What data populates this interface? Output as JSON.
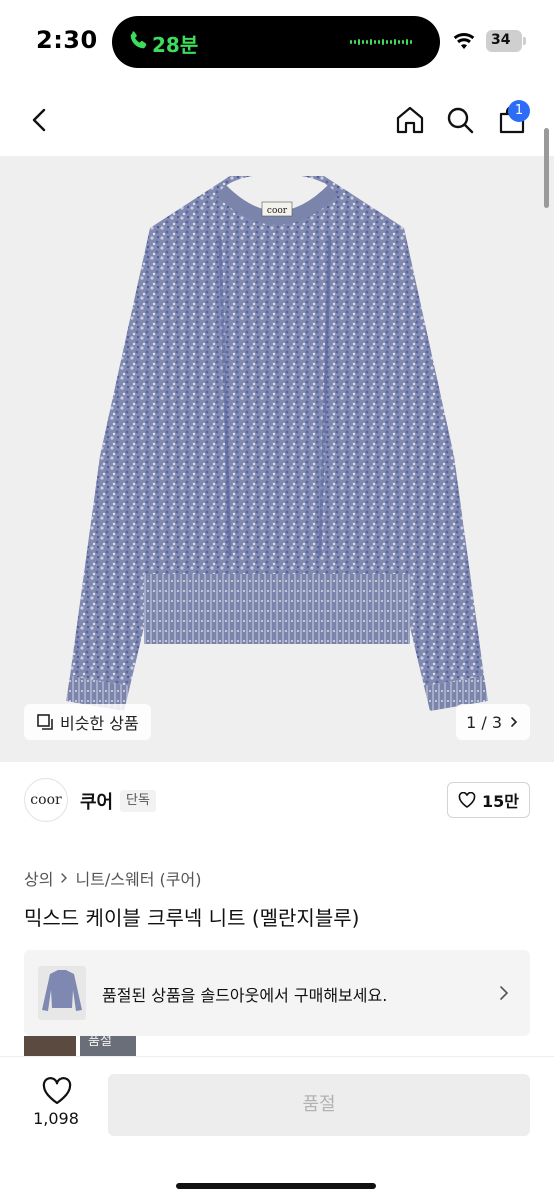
{
  "status_bar": {
    "time": "2:30",
    "call_duration": "28분",
    "battery_level": "34"
  },
  "nav": {
    "cart_count": "1",
    "icons": [
      "back-icon",
      "home-icon",
      "search-icon",
      "cart-icon"
    ]
  },
  "hero": {
    "brand_label": "coor",
    "similar_label": "비슷한 상품",
    "pager_text": "1 / 3"
  },
  "brand": {
    "logo_text": "coor",
    "name": "쿠어",
    "tag": "단독",
    "likes": "15만"
  },
  "breadcrumb": {
    "first": "상의",
    "second": "니트/스웨터 (쿠어)"
  },
  "product": {
    "title": "믹스드 케이블 크루넥 니트 (멜란지블루)"
  },
  "soldout_banner": {
    "text": "품절된 상품을 솔드아웃에서 구매해보세요."
  },
  "peek": {
    "label": "품절"
  },
  "bottom_bar": {
    "wish_count": "1,098",
    "buy_label": "품절"
  },
  "colors": {
    "accent_blue": "#2c6cf6",
    "call_green": "#3ddc5a",
    "hero_bg": "#efefef",
    "sweater_blue": "#7f88b0"
  }
}
